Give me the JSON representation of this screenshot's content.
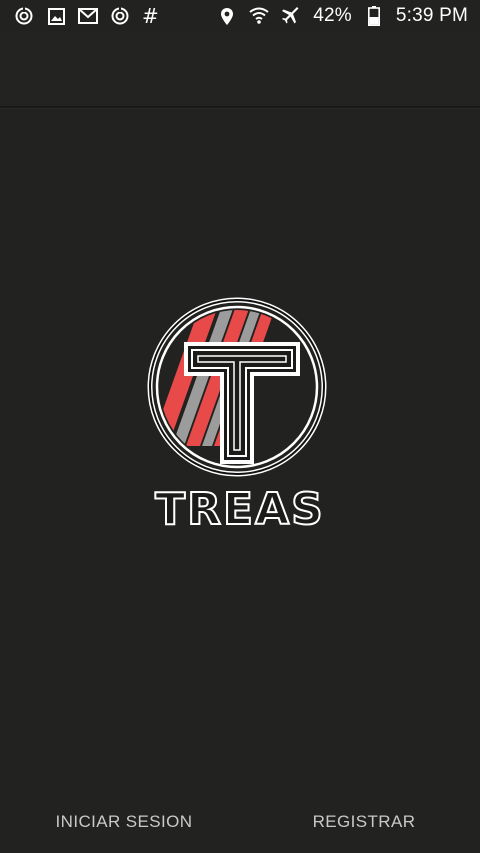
{
  "status_bar": {
    "left_icons": [
      "sync-icon",
      "image-icon",
      "gmail-icon",
      "sync-icon",
      "hash-icon"
    ],
    "hash_symbol": "#",
    "right_icons": [
      "location-icon",
      "wifi-icon",
      "airplane-icon",
      "battery-icon"
    ],
    "battery_percent": "42%",
    "time": "5:39 PM"
  },
  "logo": {
    "brand_name": "TREAS",
    "accent_color": "#e84a4a"
  },
  "actions": {
    "login_label": "INICIAR SESION",
    "register_label": "REGISTRAR"
  },
  "colors": {
    "background": "#222220",
    "text_primary": "#ffffff",
    "button_text": "#c9c9c9"
  }
}
